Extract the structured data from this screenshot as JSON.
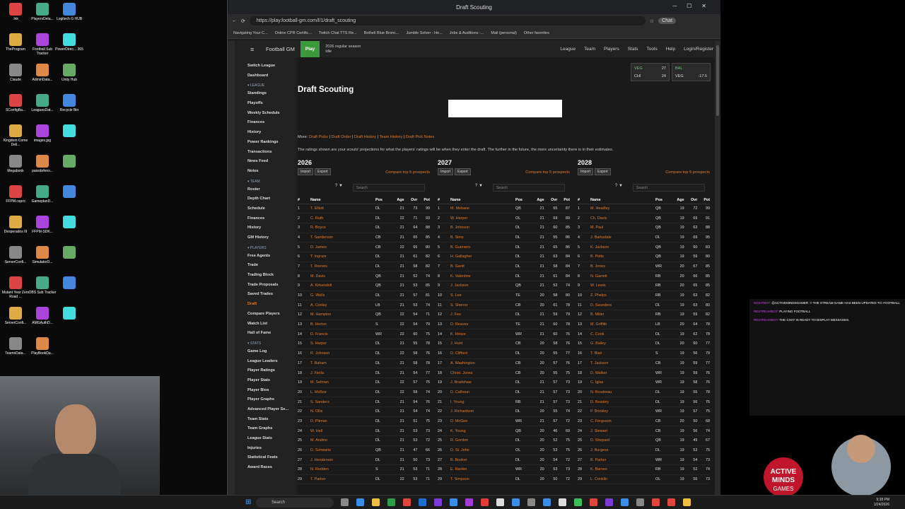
{
  "browser": {
    "tab_title": "Draft Scouting",
    "url": "https://play.football-gm.com/l/1/draft_scouting",
    "profile": "Chat",
    "bookmarks": [
      "Navigating Your C...",
      "Online CPR Certific...",
      "Twitch Chat TTS Re...",
      "Bothell Blue Bronc...",
      "Jumble Solver - He...",
      "Jobs & Auditions -...",
      "Mail (personal)",
      "Other favorites"
    ]
  },
  "desktop": {
    "icons": [
      ".lnk",
      "PlayersDeta...",
      "Logitech G HUB",
      "TheProgram",
      "Football Sub Tracker",
      "PowerDirec... 365",
      "Claude",
      "AdminData...",
      "Unity Hub",
      "SConfigBa...",
      "LeaguesDat...",
      "Recycle Bin",
      "Kingdom Come Deli...",
      "images.jpg",
      "",
      "Megabonk",
      "passdefens...",
      "",
      "FFPM.cspro",
      "GameplanD...",
      "",
      "Desperados III",
      "FFPM-SDK...",
      "",
      "ServerConfi...",
      "SimulatorD...",
      "",
      "Mutant Year Zero Road ...",
      "OBS Sub Tracker",
      "",
      "ServerConfi...",
      "AMGAuthD...",
      "",
      "TeamsData...",
      "PlayBookDa..."
    ]
  },
  "nav": {
    "brand": "Football GM",
    "play": "Play",
    "season": "2026 regular season",
    "phase": "Idle",
    "menus": [
      "League",
      "Team",
      "Players",
      "Stats",
      "Tools",
      "Help",
      "Login/Register"
    ]
  },
  "sidebar": {
    "top": [
      "Switch League",
      "Dashboard"
    ],
    "league_title": "LEAGUE",
    "league": [
      "Standings",
      "Playoffs",
      "Weekly Schedule",
      "Finances",
      "History",
      "Power Rankings",
      "Transactions",
      "News Feed",
      "Notes"
    ],
    "team_title": "TEAM",
    "team": [
      "Roster",
      "Depth Chart",
      "Schedule",
      "Finances",
      "History",
      "GM History"
    ],
    "players_title": "PLAYERS",
    "players": [
      "Free Agents",
      "Trade",
      "Trading Block",
      "Trade Proposals",
      "Saved Trades",
      "Draft",
      "Compare Players",
      "Watch List",
      "Hall of Fame"
    ],
    "stats_title": "STATS",
    "stats": [
      "Game Log",
      "League Leaders",
      "Player Ratings",
      "Player Stats",
      "Player Bios",
      "Player Graphs",
      "Advanced Player Se...",
      "Team Stats",
      "Team Graphs",
      "League Stats",
      "Injuries",
      "Statistical Feats",
      "Award Races"
    ]
  },
  "scores": [
    {
      "t1": "VEG",
      "s1": "27",
      "t2": "CHI",
      "s2": "24"
    },
    {
      "t1": "BAL",
      "s1": "",
      "t2": "VEG",
      "s2": "-17.5"
    }
  ],
  "page": {
    "title": "Draft Scouting",
    "more_label": "More:",
    "links": [
      "Draft Picks",
      "Draft Order",
      "Draft History",
      "Team History",
      "Draft Pick Notes"
    ],
    "note": "The ratings shown are your scouts' projections for what the players' ratings will be when they enter the draft. The further in the future, the more uncertainty there is in their estimates.",
    "import": "Import",
    "export": "Export",
    "compare": "Compare top 5 prospects",
    "search_placeholder": "Search",
    "headers": [
      "#",
      "Name",
      "Pos",
      "Age",
      "Ovr",
      "Pot"
    ]
  },
  "years": [
    {
      "year": "2026",
      "rows": [
        [
          "1",
          "T. Elliott",
          "DL",
          "21",
          "73",
          "99"
        ],
        [
          "2",
          "C. Ruth",
          "DL",
          "22",
          "71",
          "93"
        ],
        [
          "3",
          "R. Boyce",
          "DL",
          "21",
          "64",
          "88"
        ],
        [
          "4",
          "T. Sanderson",
          "CB",
          "21",
          "65",
          "85"
        ],
        [
          "5",
          "D. James",
          "CB",
          "22",
          "65",
          "80"
        ],
        [
          "6",
          "T. Ingram",
          "DL",
          "21",
          "61",
          "82"
        ],
        [
          "7",
          "T. Reeves",
          "DL",
          "21",
          "58",
          "82"
        ],
        [
          "8",
          "M. Davis",
          "QB",
          "21",
          "52",
          "74"
        ],
        [
          "9",
          "A. Kirkendoll",
          "QB",
          "21",
          "53",
          "85"
        ],
        [
          "10",
          "G. Wells",
          "DL",
          "21",
          "57",
          "81"
        ],
        [
          "11",
          "A. Conley",
          "LB",
          "21",
          "53",
          "74"
        ],
        [
          "12",
          "M. Hampton",
          "QB",
          "22",
          "54",
          "71"
        ],
        [
          "13",
          "B. Horton",
          "S",
          "22",
          "54",
          "79"
        ],
        [
          "14",
          "D. Francis",
          "WR",
          "22",
          "60",
          "75"
        ],
        [
          "15",
          "S. Harper",
          "DL",
          "21",
          "55",
          "78"
        ],
        [
          "16",
          "R. Johnson",
          "DL",
          "22",
          "58",
          "76"
        ],
        [
          "17",
          "T. Baham",
          "DL",
          "21",
          "58",
          "78"
        ],
        [
          "18",
          "J. Fierla",
          "DL",
          "21",
          "54",
          "77"
        ],
        [
          "19",
          "M. Selman",
          "DL",
          "22",
          "57",
          "75"
        ],
        [
          "20",
          "L. McBee",
          "DL",
          "22",
          "58",
          "74"
        ],
        [
          "21",
          "S. Sanders",
          "DL",
          "21",
          "54",
          "76"
        ],
        [
          "22",
          "N. Ollis",
          "DL",
          "21",
          "54",
          "74"
        ],
        [
          "23",
          "D. Pitman",
          "DL",
          "21",
          "51",
          "75"
        ],
        [
          "24",
          "W. Hall",
          "DL",
          "21",
          "53",
          "73"
        ],
        [
          "25",
          "M. Andino",
          "DL",
          "21",
          "53",
          "72"
        ],
        [
          "26",
          "D. Schwartz",
          "QB",
          "21",
          "47",
          "66"
        ],
        [
          "27",
          "J. Henderson",
          "DL",
          "21",
          "50",
          "73"
        ],
        [
          "28",
          "N. Redden",
          "S",
          "21",
          "53",
          "71"
        ],
        [
          "29",
          "T. Parker",
          "DL",
          "22",
          "53",
          "71"
        ]
      ]
    },
    {
      "year": "2027",
      "rows": [
        [
          "1",
          "M. Mebane",
          "QB",
          "21",
          "65",
          "87"
        ],
        [
          "2",
          "W. Harper",
          "OL",
          "21",
          "69",
          "89"
        ],
        [
          "3",
          "B. Johnson",
          "DL",
          "21",
          "60",
          "85"
        ],
        [
          "4",
          "B. Sims",
          "DL",
          "21",
          "55",
          "86"
        ],
        [
          "5",
          "B. Guerrero",
          "DL",
          "21",
          "65",
          "86"
        ],
        [
          "6",
          "H. Gallagher",
          "DL",
          "21",
          "63",
          "84"
        ],
        [
          "7",
          "B. Gantt",
          "DL",
          "21",
          "58",
          "84"
        ],
        [
          "8",
          "K. Valentine",
          "DL",
          "21",
          "61",
          "84"
        ],
        [
          "9",
          "J. Jackson",
          "QB",
          "21",
          "52",
          "74"
        ],
        [
          "10",
          "S. Lee",
          "TE",
          "20",
          "58",
          "80"
        ],
        [
          "11",
          "S. Sherrer",
          "CB",
          "20",
          "61",
          "78"
        ],
        [
          "12",
          "J. Fee",
          "DL",
          "21",
          "59",
          "79"
        ],
        [
          "13",
          "D. Reaves",
          "TE",
          "21",
          "60",
          "78"
        ],
        [
          "14",
          "K. Hintze",
          "WR",
          "21",
          "60",
          "76"
        ],
        [
          "15",
          "J. Hunt",
          "CB",
          "20",
          "58",
          "76"
        ],
        [
          "16",
          "D. Clifford",
          "DL",
          "20",
          "55",
          "77"
        ],
        [
          "17",
          "A. Washington",
          "CB",
          "20",
          "57",
          "76"
        ],
        [
          "18",
          "Christ. Jones",
          "CB",
          "20",
          "55",
          "75"
        ],
        [
          "19",
          "J. Bradshaw",
          "DL",
          "21",
          "57",
          "73"
        ],
        [
          "20",
          "D. Calhoun",
          "DL",
          "21",
          "57",
          "73"
        ],
        [
          "21",
          "I. Young",
          "RB",
          "21",
          "57",
          "73"
        ],
        [
          "22",
          "J. Richardson",
          "DL",
          "20",
          "55",
          "74"
        ],
        [
          "23",
          "D. McGee",
          "WR",
          "21",
          "57",
          "72"
        ],
        [
          "24",
          "K. Young",
          "QB",
          "20",
          "46",
          "69"
        ],
        [
          "25",
          "R. Gordon",
          "DL",
          "20",
          "52",
          "75"
        ],
        [
          "26",
          "D. St. John",
          "OL",
          "20",
          "53",
          "75"
        ],
        [
          "27",
          "B. Booker",
          "DL",
          "20",
          "54",
          "72"
        ],
        [
          "28",
          "E. Rankin",
          "WR",
          "20",
          "53",
          "73"
        ],
        [
          "29",
          "T. Simpson",
          "DL",
          "20",
          "50",
          "72"
        ]
      ]
    },
    {
      "year": "2028",
      "rows": [
        [
          "1",
          "M. Headley",
          "QB",
          "19",
          "72",
          "99"
        ],
        [
          "2",
          "Ch. Davis",
          "QB",
          "19",
          "69",
          "91"
        ],
        [
          "3",
          "M. Paul",
          "QB",
          "19",
          "63",
          "88"
        ],
        [
          "4",
          "J. Barksdale",
          "DL",
          "19",
          "69",
          "95"
        ],
        [
          "5",
          "K. Jackson",
          "QB",
          "19",
          "60",
          "83"
        ],
        [
          "6",
          "B. Potts",
          "QB",
          "19",
          "59",
          "80"
        ],
        [
          "7",
          "B. Jones",
          "WR",
          "20",
          "67",
          "85"
        ],
        [
          "8",
          "N. Garrett",
          "RB",
          "20",
          "66",
          "85"
        ],
        [
          "9",
          "W. Lewis",
          "RB",
          "20",
          "65",
          "85"
        ],
        [
          "10",
          "Z. Phelps",
          "RB",
          "19",
          "63",
          "82"
        ],
        [
          "11",
          "D. Saunders",
          "DL",
          "19",
          "63",
          "80"
        ],
        [
          "12",
          "B. Miller",
          "RB",
          "19",
          "59",
          "82"
        ],
        [
          "13",
          "M. Griffith",
          "LB",
          "20",
          "64",
          "78"
        ],
        [
          "14",
          "C. Cook",
          "DL",
          "19",
          "62",
          "78"
        ],
        [
          "15",
          "G. Bailey",
          "DL",
          "20",
          "60",
          "77"
        ],
        [
          "16",
          "T. Blair",
          "S",
          "19",
          "56",
          "79"
        ],
        [
          "17",
          "T. Jackson",
          "CB",
          "19",
          "59",
          "77"
        ],
        [
          "18",
          "D. Walker",
          "WR",
          "19",
          "59",
          "76"
        ],
        [
          "19",
          "C. Iglas",
          "WR",
          "19",
          "58",
          "76"
        ],
        [
          "20",
          "N. Boudreau",
          "DL",
          "19",
          "55",
          "78"
        ],
        [
          "21",
          "D. Beasley",
          "DL",
          "19",
          "56",
          "75"
        ],
        [
          "22",
          "P. Brinkley",
          "WR",
          "19",
          "57",
          "75"
        ],
        [
          "23",
          "C. Ferguson",
          "CB",
          "20",
          "50",
          "68"
        ],
        [
          "24",
          "J. Stewart",
          "CB",
          "19",
          "56",
          "74"
        ],
        [
          "25",
          "D. Shepard",
          "QB",
          "19",
          "49",
          "67"
        ],
        [
          "26",
          "J. Burgess",
          "DL",
          "19",
          "53",
          "75"
        ],
        [
          "27",
          "B. Parker",
          "WR",
          "19",
          "54",
          "73"
        ],
        [
          "28",
          "K. Barnes",
          "RB",
          "19",
          "52",
          "74"
        ],
        [
          "29",
          "L. Conklin",
          "OL",
          "19",
          "55",
          "73"
        ]
      ]
    }
  ],
  "chat": [
    {
      "user": "NIGHTBOT:",
      "msg": "@ACTIVEMINDSGAMER -> THE STREAM GAME HAS BEEN UPDATED TO: FOOTBALL"
    },
    {
      "user": "RESTREAMBOT:",
      "msg": "PLAYING FOOTBALL"
    },
    {
      "user": "RESTREAMBOT:",
      "msg": "THE CHAT IS READY TO DISPLAY MESSAGES."
    }
  ],
  "taskbar": {
    "search": "Search",
    "time": "9:38 PM",
    "date": "1/24/2026"
  },
  "logo": {
    "line1": "ACTIVE",
    "line2": "MINDS",
    "line3": "GAMES"
  }
}
